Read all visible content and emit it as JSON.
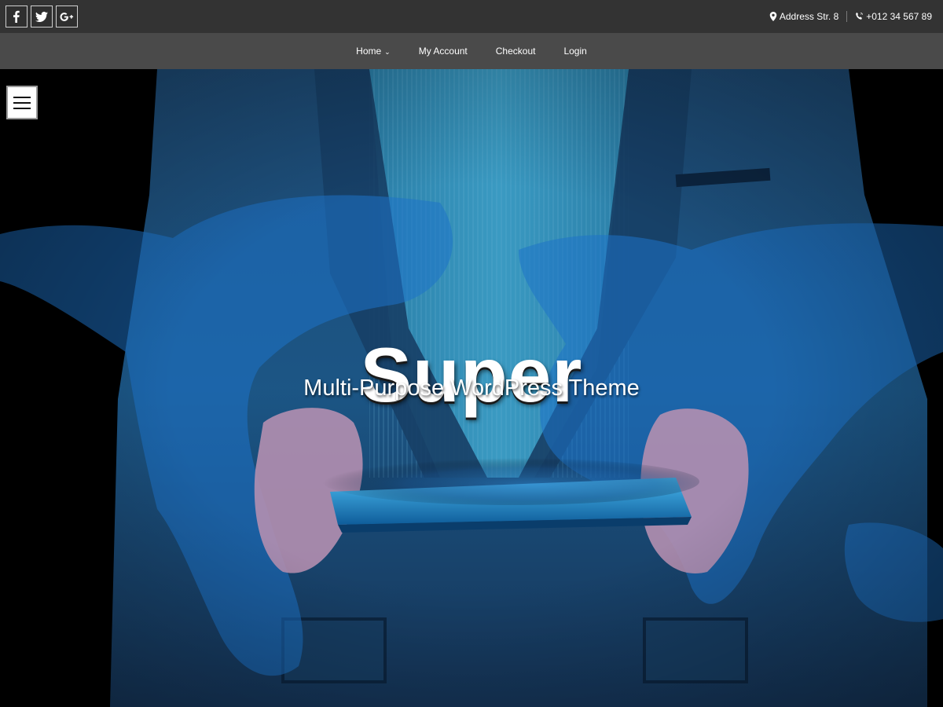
{
  "social": [
    {
      "icon": "facebook-icon",
      "label": "f"
    },
    {
      "icon": "twitter-icon",
      "label": ""
    },
    {
      "icon": "google-plus-icon",
      "label": "G+"
    }
  ],
  "contact": {
    "address": "Address Str. 8",
    "phone": "+012 34 567 89"
  },
  "nav": {
    "items": [
      {
        "label": "Home"
      },
      {
        "label": "My Account"
      },
      {
        "label": "Checkout"
      },
      {
        "label": "Login"
      }
    ]
  },
  "hero": {
    "title": "Super",
    "subtitle": "Multi-Purpose WordPress Theme"
  },
  "colors": {
    "topbar": "#333333",
    "navbar": "#4a4a4a",
    "hero_blue": "#1a5fa8",
    "text": "#ffffff"
  }
}
